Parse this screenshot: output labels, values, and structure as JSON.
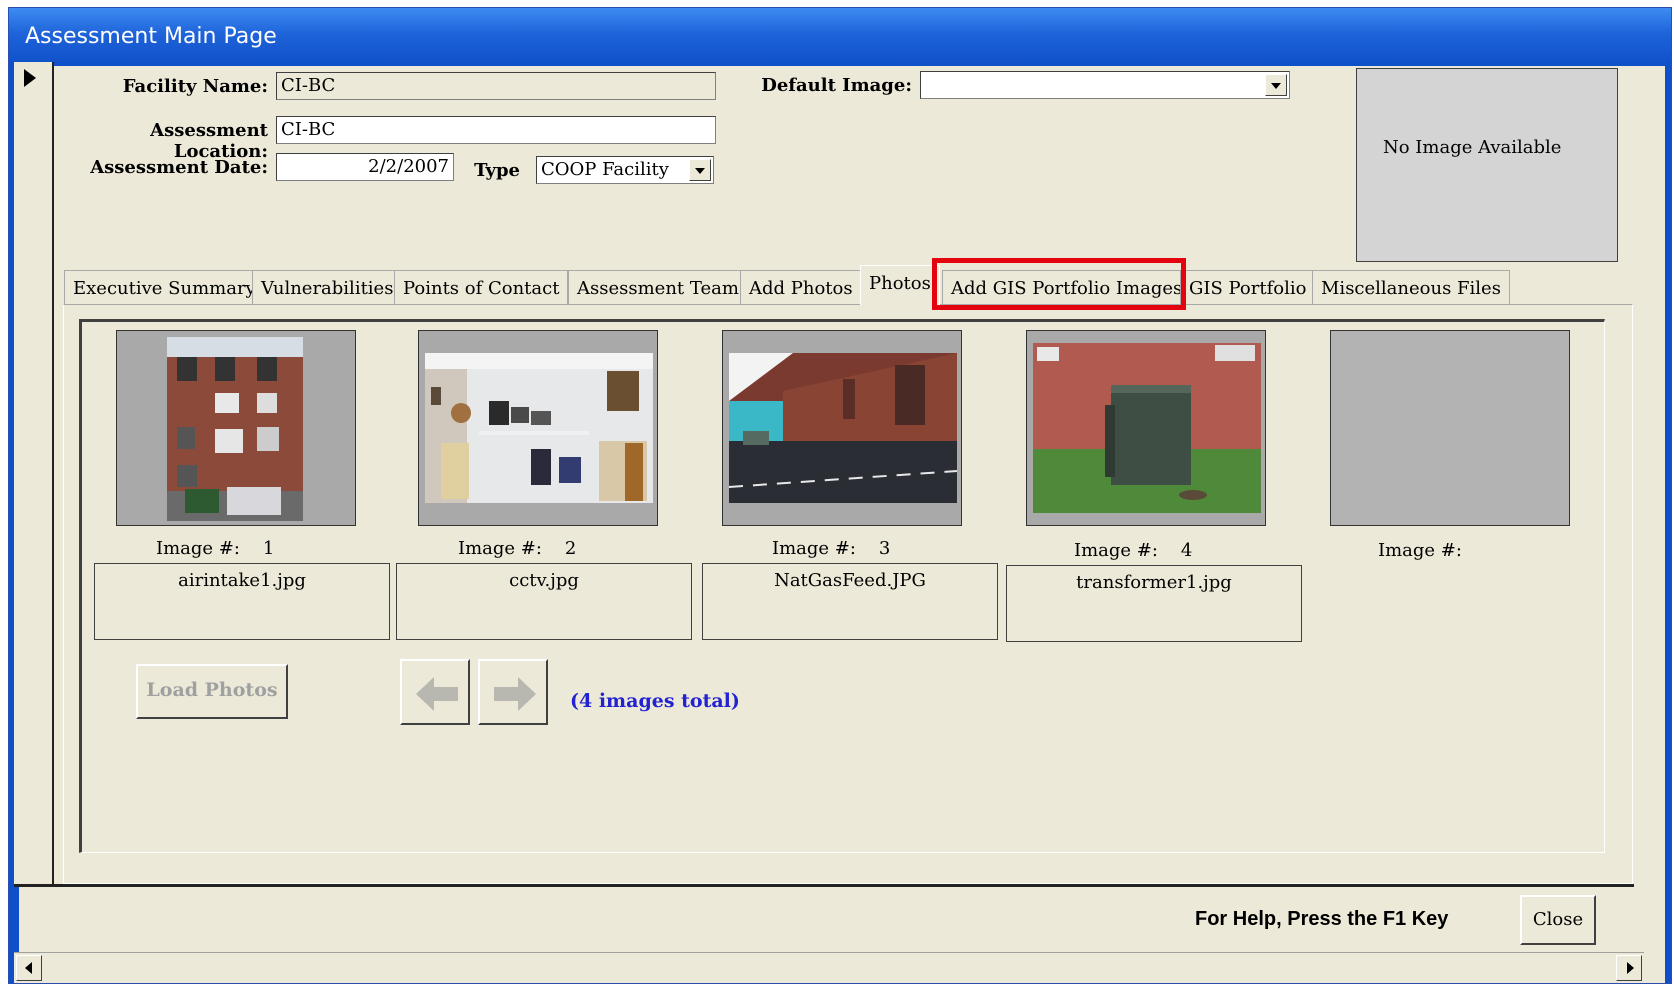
{
  "window": {
    "title": "Assessment Main Page"
  },
  "form": {
    "facility_name_label": "Facility Name:",
    "facility_name_value": "CI-BC",
    "assessment_location_label": "Assessment Location:",
    "assessment_location_value": "CI-BC",
    "assessment_date_label": "Assessment Date:",
    "assessment_date_value": "2/2/2007",
    "type_label": "Type",
    "type_value": "COOP Facility",
    "default_image_label": "Default Image:",
    "default_image_value": "",
    "no_image_text": "No Image Available"
  },
  "tabs": [
    {
      "label": "Executive Summary"
    },
    {
      "label": "Vulnerabilities"
    },
    {
      "label": "Points of Contact"
    },
    {
      "label": "Assessment Team"
    },
    {
      "label": "Add Photos"
    },
    {
      "label": "Photos",
      "active": true
    },
    {
      "label": "Add GIS Portfolio Images",
      "highlighted": true
    },
    {
      "label": "GIS Portfolio"
    },
    {
      "label": "Miscellaneous Files"
    }
  ],
  "photos": [
    {
      "image_label": "Image #:",
      "number": "1",
      "filename": "airintake1.jpg"
    },
    {
      "image_label": "Image #:",
      "number": "2",
      "filename": "cctv.jpg"
    },
    {
      "image_label": "Image #:",
      "number": "3",
      "filename": "NatGasFeed.JPG"
    },
    {
      "image_label": "Image #:",
      "number": "4",
      "filename": "transformer1.jpg"
    },
    {
      "image_label": "Image #:",
      "number": "",
      "filename": ""
    }
  ],
  "actions": {
    "load_photos_label": "Load Photos",
    "images_total": "(4 images total)",
    "prev_icon": "arrow-left-icon",
    "next_icon": "arrow-right-icon"
  },
  "footer": {
    "help_text": "For Help, Press the F1 Key",
    "close_label": "Close"
  },
  "colors": {
    "highlight": "#e4040f",
    "images_total_text": "#2222d0",
    "titlebar": "#1e63d9"
  }
}
